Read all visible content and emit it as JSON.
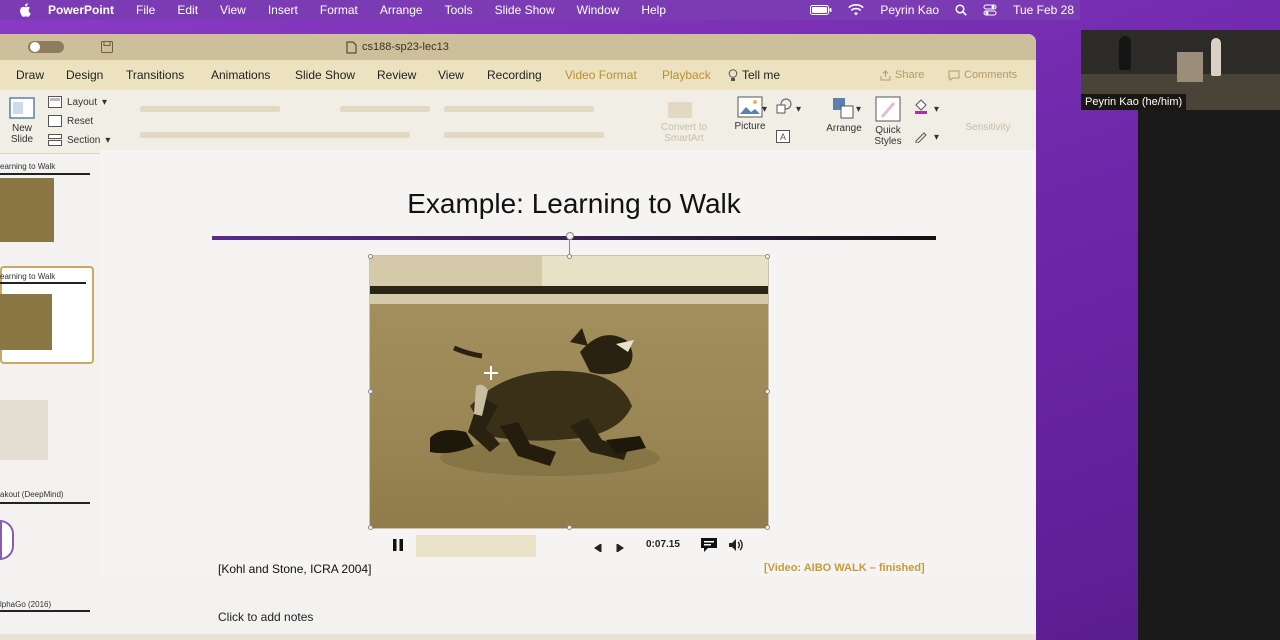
{
  "menubar": {
    "app_name": "PowerPoint",
    "items": [
      "File",
      "Edit",
      "View",
      "Insert",
      "Format",
      "Arrange",
      "Tools",
      "Slide Show",
      "Window",
      "Help"
    ],
    "user": "Peyrin Kao",
    "datetime": "Tue Feb 28"
  },
  "window": {
    "doc_title": "cs188-sp23-lec13"
  },
  "tabs": [
    "Draw",
    "Design",
    "Transitions",
    "Animations",
    "Slide Show",
    "Review",
    "View",
    "Recording",
    "Video Format",
    "Playback"
  ],
  "tell_me": "Tell me",
  "share": "Share",
  "comments": "Comments",
  "ribbon": {
    "new_slide": "New Slide",
    "layout": "Layout",
    "reset": "Reset",
    "section": "Section",
    "convert_smartart": "Convert to SmartArt",
    "picture": "Picture",
    "arrange": "Arrange",
    "quick_styles": "Quick Styles",
    "sensitivity": "Sensitivity"
  },
  "thumbnails": {
    "t1_title": "earning to Walk",
    "t2_title": "earning to Walk",
    "t3_title": "akout (DeepMind)",
    "t4_title": "lphaGo (2016)"
  },
  "slide": {
    "title": "Example: Learning to Walk",
    "citation": "[Kohl and Stone, ICRA 2004]",
    "video_status": "[Video: AIBO WALK – finished]",
    "time": "0:07.15",
    "progress": 1.0
  },
  "notes_placeholder": "Click to add notes",
  "zoom": {
    "participant_name": "Peyrin Kao (he/him)"
  },
  "colors": {
    "accent_gold": "#b8902f",
    "desktop_purple": "#7a2fb0"
  }
}
